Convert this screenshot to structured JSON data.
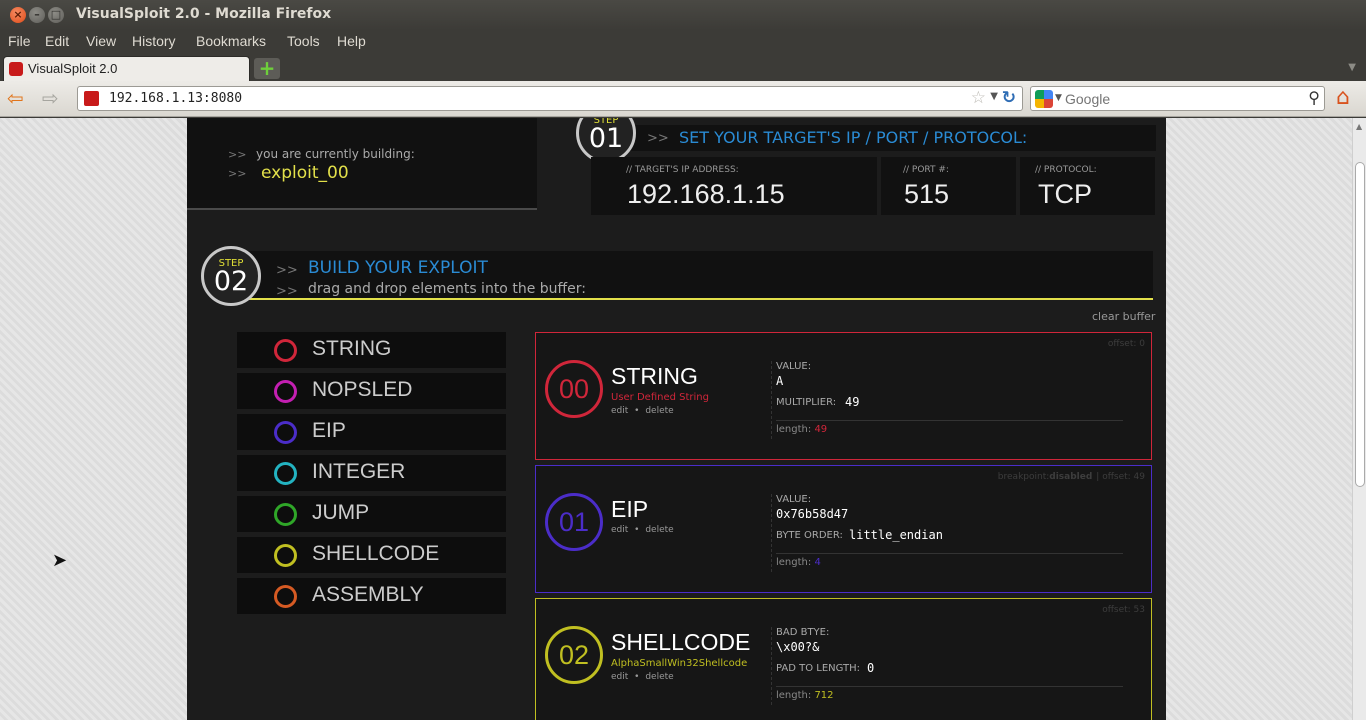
{
  "window": {
    "title": "VisualSploit 2.0 - Mozilla Firefox"
  },
  "menu": [
    "File",
    "Edit",
    "View",
    "History",
    "Bookmarks",
    "Tools",
    "Help"
  ],
  "tab": {
    "label": "VisualSploit 2.0"
  },
  "nav": {
    "url": "192.168.1.13:8080",
    "search_placeholder": "Google"
  },
  "app": {
    "building_prompt": "you are currently building:",
    "exploit_name": "exploit_00",
    "chevron": ">>",
    "step1": {
      "word": "STEP",
      "num": "01",
      "title": "SET YOUR TARGET'S IP / PORT / PROTOCOL:",
      "ip_label": "// TARGET'S IP ADDRESS:",
      "ip_value": "192.168.1.15",
      "port_label": "// PORT #:",
      "port_value": "515",
      "protocol_label": "// PROTOCOL:",
      "protocol_value": "TCP"
    },
    "step2": {
      "word": "STEP",
      "num": "02",
      "title": "BUILD YOUR EXPLOIT",
      "subtitle": "drag and drop elements into the buffer:"
    },
    "clear_buffer": "clear buffer",
    "palette": [
      {
        "label": "STRING",
        "color": "#d0263a"
      },
      {
        "label": "NOPSLED",
        "color": "#c41fb2"
      },
      {
        "label": "EIP",
        "color": "#4b2dc9"
      },
      {
        "label": "INTEGER",
        "color": "#23b3c1"
      },
      {
        "label": "JUMP",
        "color": "#2fa628"
      },
      {
        "label": "SHELLCODE",
        "color": "#c0bf21"
      },
      {
        "label": "ASSEMBLY",
        "color": "#d55a23"
      }
    ],
    "buffer": [
      {
        "index": "00",
        "name": "STRING",
        "subtitle": "User Defined String",
        "color": "#d0263a",
        "offset": "offset: 0",
        "edit": "edit",
        "sep": "•",
        "delete": "delete",
        "f1_label": "VALUE:",
        "f1_value": "A",
        "f2_label": "MULTIPLIER:",
        "f2_value": "49",
        "length_label": "length:",
        "length": "49"
      },
      {
        "index": "01",
        "name": "EIP",
        "color": "#4b2dc9",
        "breakpoint_label": "breakpoint:",
        "breakpoint_value": "disabled",
        "offset": "| offset: 49",
        "edit": "edit",
        "sep": "•",
        "delete": "delete",
        "f1_label": "VALUE:",
        "f1_value": "0x76b58d47",
        "f2_label": "BYTE ORDER:",
        "f2_value": "little_endian",
        "length_label": "length:",
        "length": "4"
      },
      {
        "index": "02",
        "name": "SHELLCODE",
        "subtitle": "AlphaSmallWin32Shellcode",
        "color": "#c0bf21",
        "offset": "offset: 53",
        "edit": "edit",
        "sep": "•",
        "delete": "delete",
        "f1_label": "BAD BTYE:",
        "f1_value": "\\x00?&",
        "f2_label": "PAD TO LENGTH:",
        "f2_value": "0",
        "length_label": "length:",
        "length": "712"
      }
    ]
  }
}
